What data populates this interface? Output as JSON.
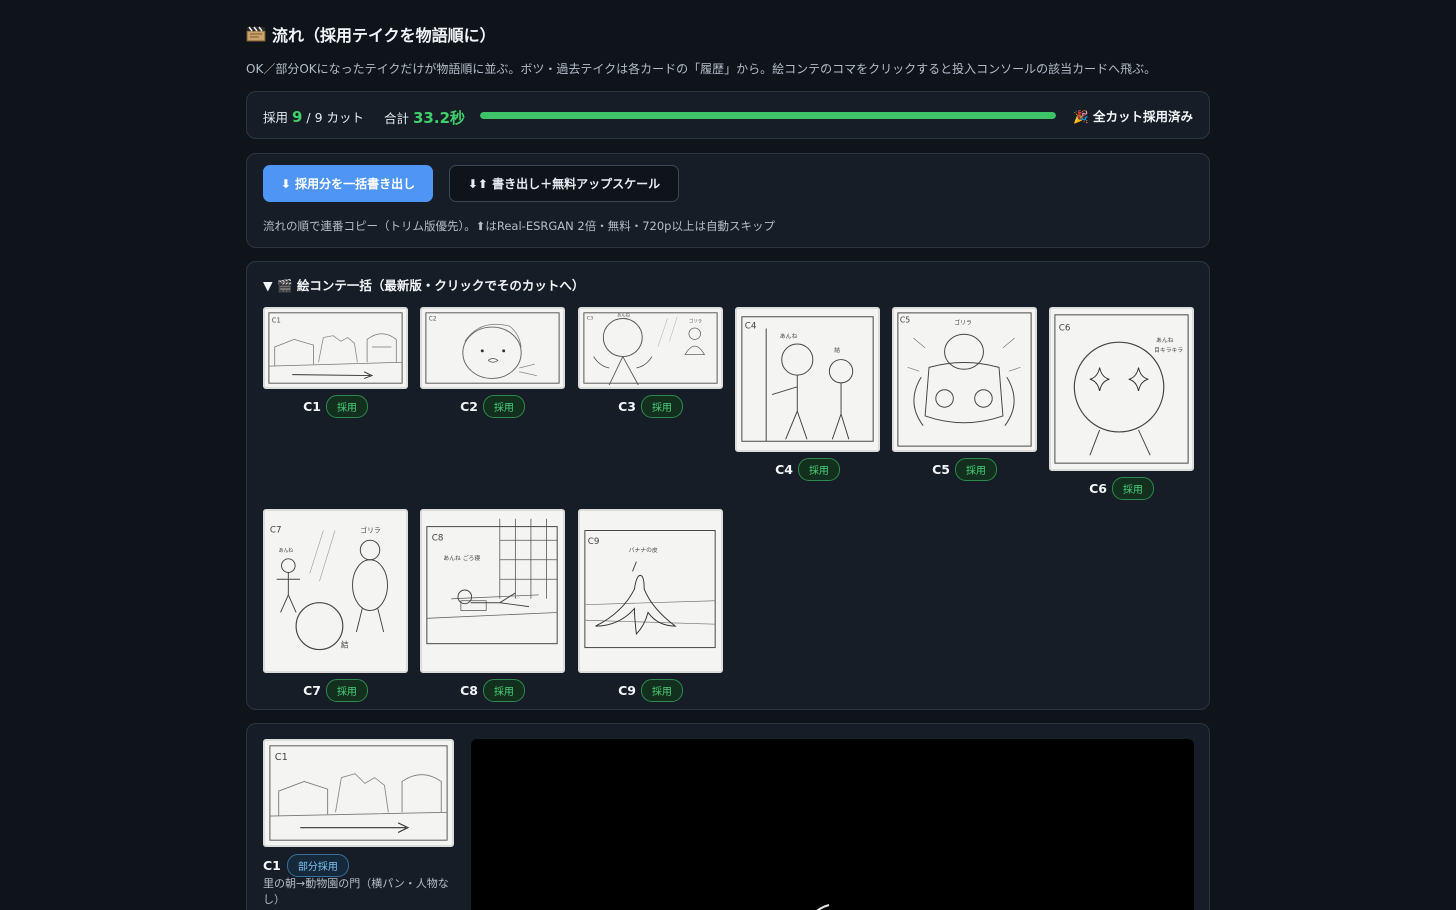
{
  "header": {
    "title": "流れ（採用テイクを物語順に）",
    "title_icon": "clapperboard-icon",
    "description": "OK／部分OKになったテイクだけが物語順に並ぶ。ボツ・過去テイクは各カードの「履歴」から。絵コンテのコマをクリックすると投入コンソールの該当カードへ飛ぶ。"
  },
  "status": {
    "adopted_label": "採用",
    "adopted_count": "9",
    "total_cuts": "/ 9 カット",
    "sum_label": "合計",
    "sum_value": "33.2秒",
    "progress_fraction": 1.0,
    "done_text": "🎉 全カット採用済み",
    "accent": "#3ec26a"
  },
  "export": {
    "bulk_button": "⬇ 採用分を一括書き出し",
    "upscale_button": "⬇⬆ 書き出し＋無料アップスケール",
    "note": "流れの順で連番コピー（トリム版優先）。⬆はReal-ESRGAN 2倍・無料・720p以上は自動スキップ",
    "primary_color": "#4f95f5"
  },
  "storyboard": {
    "heading": "▼ 🎬 絵コンテ一括（最新版・クリックでそのカットへ）",
    "frames": [
      {
        "cut": "C1",
        "status": "採用"
      },
      {
        "cut": "C2",
        "status": "採用"
      },
      {
        "cut": "C3",
        "status": "採用"
      },
      {
        "cut": "C4",
        "status": "採用"
      },
      {
        "cut": "C5",
        "status": "採用"
      },
      {
        "cut": "C6",
        "status": "採用"
      },
      {
        "cut": "C7",
        "status": "採用"
      },
      {
        "cut": "C8",
        "status": "採用"
      },
      {
        "cut": "C9",
        "status": "採用"
      }
    ],
    "sketch_text": {
      "c1": "C1",
      "c2": "C2",
      "c3": "C3",
      "c3_a": "あんね",
      "c3_b": "ゴリラ",
      "c4": "C4",
      "c4_a": "あんね",
      "c4_b": "結",
      "c5": "C5",
      "c5_a": "ゴリラ",
      "c6": "C6",
      "c6_a": "あんね",
      "c6_b": "目キラキラ",
      "c7": "C7",
      "c7_a": "あんね",
      "c7_b": "ゴリラ",
      "c7_c": "結",
      "c8": "C8",
      "c8_a": "あんね ごろ寝",
      "c9": "C9",
      "c9_a": "バナナの皮"
    }
  },
  "console": {
    "cut": "C1",
    "status": "部分採用",
    "description": "里の朝→動物園の門（横パン・人物なし）",
    "sketch_label": "C1"
  }
}
